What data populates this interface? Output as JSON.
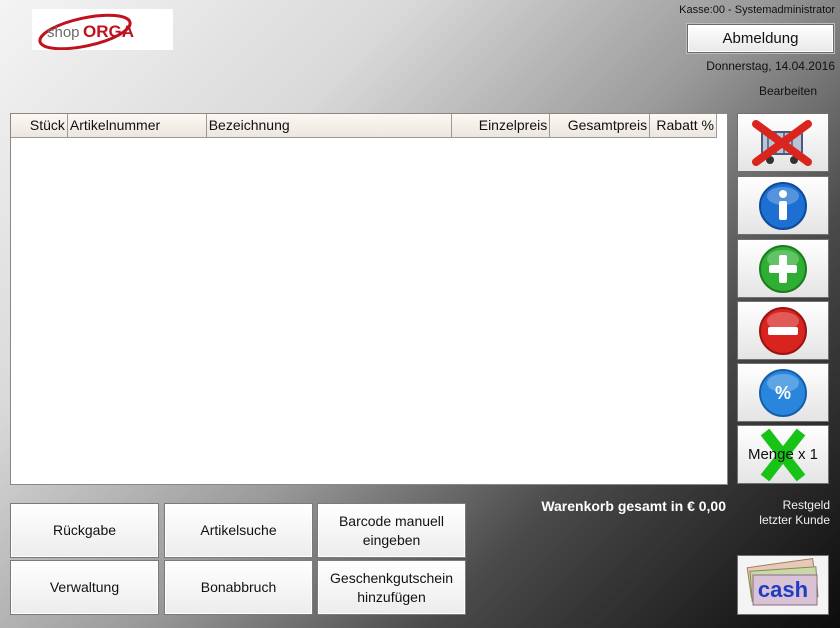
{
  "logo": {
    "text_shop": "shop",
    "text_orga": "ORGA"
  },
  "header": {
    "kasse_info": "Kasse:00 - Systemadministrator",
    "logout_label": "Abmeldung",
    "date": "Donnerstag, 14.04.2016",
    "edit_label": "Bearbeiten"
  },
  "table": {
    "columns": [
      "Stück",
      "Artikelnummer",
      "Bezeichnung",
      "Einzelpreis",
      "Gesamtpreis",
      "Rabatt %"
    ],
    "rows": []
  },
  "side_buttons": {
    "icons": [
      "delete-cart-icon",
      "info-icon",
      "plus-icon",
      "minus-icon",
      "percent-icon",
      "quantity-multiply-icon"
    ],
    "quantity_label": "Menge x 1"
  },
  "totals": {
    "cart_total_label": "Warenkorb gesamt in € 0,00",
    "change_line1": "Restgeld",
    "change_line2": "letzter Kunde"
  },
  "bottom_buttons": {
    "return": "Rückgabe",
    "article_search": "Artikelsuche",
    "barcode_line1": "Barcode manuell",
    "barcode_line2": "eingeben",
    "admin": "Verwaltung",
    "cancel_receipt": "Bonabbruch",
    "voucher_line1": "Geschenkgutschein",
    "voucher_line2": "hinzufügen",
    "cash_label": "cash"
  },
  "colors": {
    "logo_red": "#c0111f",
    "info_blue": "#1d6fd1",
    "plus_green": "#2fae33",
    "minus_red": "#d8231f",
    "cancel_red": "#d9251d",
    "quantity_green": "#18c318",
    "cash_blue": "#1e3cc4"
  }
}
